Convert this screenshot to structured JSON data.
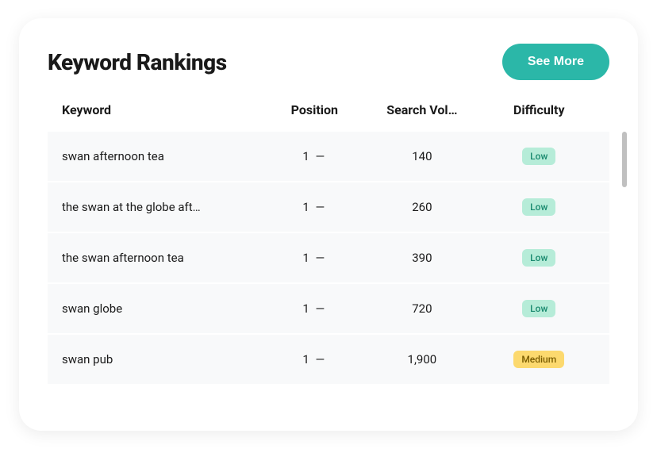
{
  "header": {
    "title": "Keyword Rankings",
    "see_more_label": "See More"
  },
  "table": {
    "columns": {
      "keyword": "Keyword",
      "position": "Position",
      "search_vol": "Search Vol…",
      "difficulty": "Difficulty"
    },
    "rows": [
      {
        "keyword": "swan afternoon tea",
        "position": "1 —",
        "search_vol": "140",
        "difficulty": "Low",
        "difficulty_level": "low"
      },
      {
        "keyword": "the swan at the globe aft…",
        "position": "1 —",
        "search_vol": "260",
        "difficulty": "Low",
        "difficulty_level": "low"
      },
      {
        "keyword": "the swan afternoon tea",
        "position": "1 —",
        "search_vol": "390",
        "difficulty": "Low",
        "difficulty_level": "low"
      },
      {
        "keyword": "swan globe",
        "position": "1 —",
        "search_vol": "720",
        "difficulty": "Low",
        "difficulty_level": "low"
      },
      {
        "keyword": "swan pub",
        "position": "1 —",
        "search_vol": "1,900",
        "difficulty": "Medium",
        "difficulty_level": "medium"
      }
    ]
  },
  "colors": {
    "accent": "#2bb7a8",
    "badge_low_bg": "#b6ecd8",
    "badge_low_fg": "#1a8a6f",
    "badge_medium_bg": "#fcd96e",
    "badge_medium_fg": "#7a5c00"
  }
}
